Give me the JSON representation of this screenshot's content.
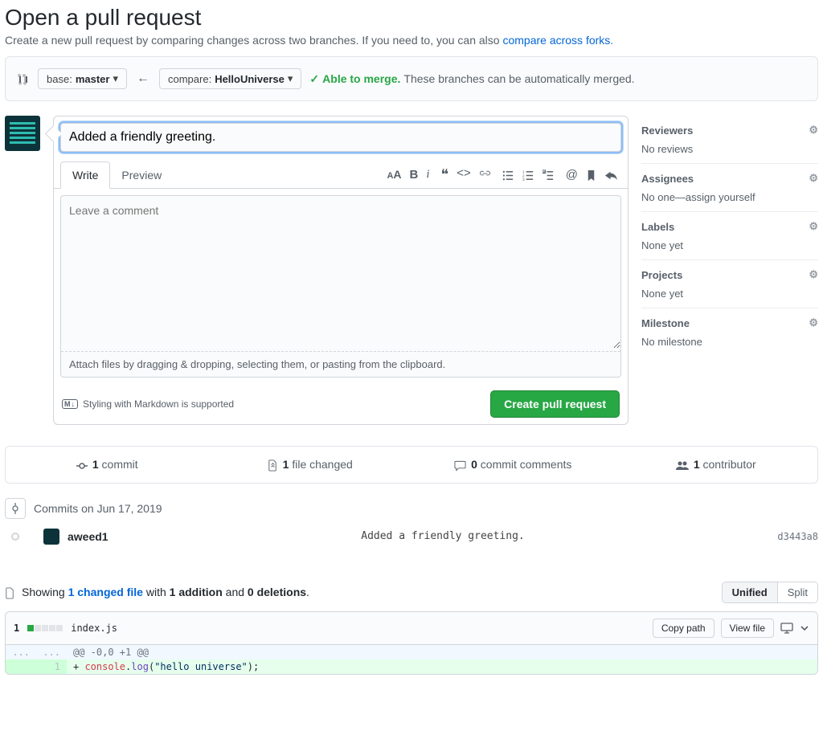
{
  "header": {
    "title": "Open a pull request",
    "subtitle_pre": "Create a new pull request by comparing changes across two branches. If you need to, you can also ",
    "subtitle_link": "compare across forks",
    "subtitle_post": "."
  },
  "compare": {
    "base_prefix": "base: ",
    "base_branch": "master",
    "compare_prefix": "compare: ",
    "compare_branch": "HelloUniverse",
    "status_able": "Able to merge.",
    "status_rest": " These branches can be automatically merged."
  },
  "editor": {
    "title_value": "Added a friendly greeting.",
    "tab_write": "Write",
    "tab_preview": "Preview",
    "comment_placeholder": "Leave a comment",
    "dropzone": "Attach files by dragging & dropping, selecting them, or pasting from the clipboard.",
    "md_hint": "Styling with Markdown is supported",
    "md_badge": "M↓",
    "submit": "Create pull request"
  },
  "sidebar": {
    "reviewers": {
      "title": "Reviewers",
      "body": "No reviews"
    },
    "assignees": {
      "title": "Assignees",
      "body": "No one—assign yourself"
    },
    "labels": {
      "title": "Labels",
      "body": "None yet"
    },
    "projects": {
      "title": "Projects",
      "body": "None yet"
    },
    "milestone": {
      "title": "Milestone",
      "body": "No milestone"
    }
  },
  "stats": {
    "commits_n": "1",
    "commits_label": " commit",
    "files_n": "1",
    "files_label": " file changed",
    "comments_n": "0",
    "comments_label": " commit comments",
    "contrib_n": "1",
    "contrib_label": " contributor"
  },
  "commits": {
    "heading": "Commits on Jun 17, 2019",
    "author": "aweed1",
    "message": "Added a friendly greeting.",
    "sha": "d3443a8"
  },
  "diff": {
    "showing_pre": "Showing ",
    "changed_link": "1 changed file",
    "mid1": " with ",
    "additions": "1 addition",
    "mid2": " and ",
    "deletions": "0 deletions",
    "end": ".",
    "unified": "Unified",
    "split": "Split",
    "add_count": "1",
    "file_name": "index.js",
    "copy_path": "Copy path",
    "view_file": "View file",
    "hunk_marker": "...",
    "hunk_header": "@@ -0,0 +1 @@",
    "line_no": "1",
    "plus": "+ ",
    "tok1": "console",
    "tok2": ".",
    "tok3": "log",
    "tok4": "(",
    "tok5": "\"hello universe\"",
    "tok6": ");"
  }
}
